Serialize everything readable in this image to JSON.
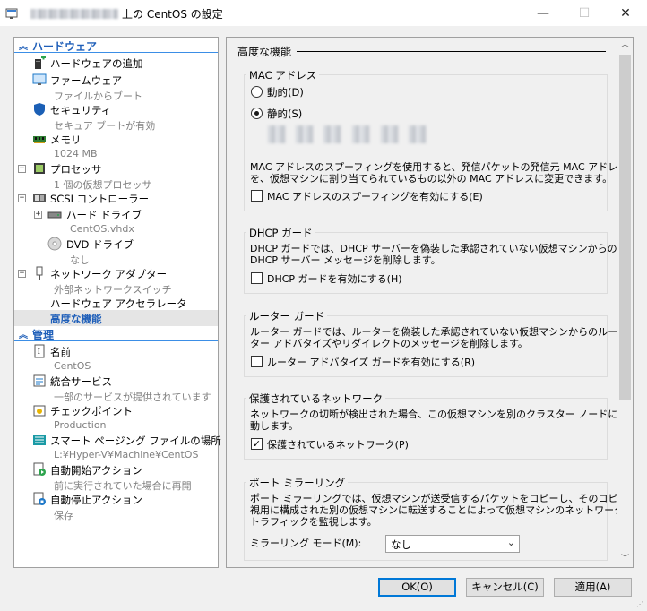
{
  "window": {
    "title_suffix": "上の CentOS の設定",
    "min_glyph": "—",
    "max_glyph": "☐",
    "close_glyph": "✕"
  },
  "hardware_section": {
    "label": "ハードウェア"
  },
  "management_section": {
    "label": "管理"
  },
  "hardware_items": [
    {
      "label": "ハードウェアの追加",
      "sub": "",
      "icon": "add-hardware-icon"
    },
    {
      "label": "ファームウェア",
      "sub": "ファイルからブート",
      "icon": "firmware-icon"
    },
    {
      "label": "セキュリティ",
      "sub": "セキュア ブートが有効",
      "icon": "shield-icon"
    },
    {
      "label": "メモリ",
      "sub": "1024 MB",
      "icon": "memory-icon"
    },
    {
      "label": "プロセッサ",
      "sub": "1 個の仮想プロセッサ",
      "icon": "processor-icon"
    },
    {
      "label": "SCSI コントローラー",
      "sub": "",
      "icon": "scsi-controller-icon"
    },
    {
      "label": "ハード ドライブ",
      "sub": "CentOS.vhdx",
      "icon": "hard-drive-icon"
    },
    {
      "label": "DVD ドライブ",
      "sub": "なし",
      "icon": "dvd-icon"
    },
    {
      "label": "ネットワーク アダプター",
      "sub": "外部ネットワークスイッチ",
      "icon": "network-adapter-icon"
    },
    {
      "label": "ハードウェア アクセラレータ",
      "sub": "",
      "icon": ""
    },
    {
      "label": "高度な機能",
      "sub": "",
      "icon": ""
    }
  ],
  "management_items": [
    {
      "label": "名前",
      "sub": "CentOS",
      "icon": "name-icon"
    },
    {
      "label": "統合サービス",
      "sub": "一部のサービスが提供されています",
      "icon": "integration-services-icon"
    },
    {
      "label": "チェックポイント",
      "sub": "Production",
      "icon": "checkpoint-icon"
    },
    {
      "label": "スマート ページング ファイルの場所",
      "sub": "L:¥Hyper-V¥Machine¥CentOS",
      "icon": "smart-paging-icon"
    },
    {
      "label": "自動開始アクション",
      "sub": "前に実行されていた場合に再開",
      "icon": "auto-start-icon"
    },
    {
      "label": "自動停止アクション",
      "sub": "保存",
      "icon": "auto-stop-icon"
    }
  ],
  "advanced": {
    "title": "高度な機能",
    "mac": {
      "title": "MAC アドレス",
      "dynamic_label": "動的(D)",
      "static_label": "静的(S)",
      "selected": "static",
      "desc_line1": "MAC アドレスのスプーフィングを使用すると、発信パケットの発信元 MAC アドレス",
      "desc_line2": "を、仮想マシンに割り当てられているもの以外の MAC アドレスに変更できます。",
      "spoof_label": "MAC アドレスのスプーフィングを有効にする(E)",
      "spoof_checked": false
    },
    "dhcp": {
      "title": "DHCP ガード",
      "desc_line1": "DHCP ガードでは、DHCP サーバーを偽装した承認されていない仮想マシンからの",
      "desc_line2": "DHCP サーバー メッセージを削除します。",
      "check_label": "DHCP ガードを有効にする(H)",
      "checked": false
    },
    "router": {
      "title": "ルーター ガード",
      "desc_line1": "ルーター ガードでは、ルーターを偽装した承認されていない仮想マシンからのルー",
      "desc_line2": "ター アドバタイズやリダイレクトのメッセージを削除します。",
      "check_label": "ルーター アドバタイズ ガードを有効にする(R)",
      "checked": false
    },
    "protected": {
      "title": "保護されているネットワーク",
      "desc_line1": "ネットワークの切断が検出された場合、この仮想マシンを別のクラスター ノードに移",
      "desc_line2": "動します。",
      "check_label": "保護されているネットワーク(P)",
      "checked": true,
      "check_glyph": "✓"
    },
    "mirroring": {
      "title": "ポート ミラーリング",
      "desc_line1": "ポート ミラーリングでは、仮想マシンが送受信するパケットをコピーし、そのコピーを監",
      "desc_line2": "視用に構成された別の仮想マシンに転送することによって仮想マシンのネットワーク",
      "desc_line3": "トラフィックを監視します。",
      "mode_label": "ミラーリング モード(M):",
      "mode_value": "なし"
    }
  },
  "buttons": {
    "ok": "OK(O)",
    "cancel": "キャンセル(C)",
    "apply": "適用(A)"
  }
}
